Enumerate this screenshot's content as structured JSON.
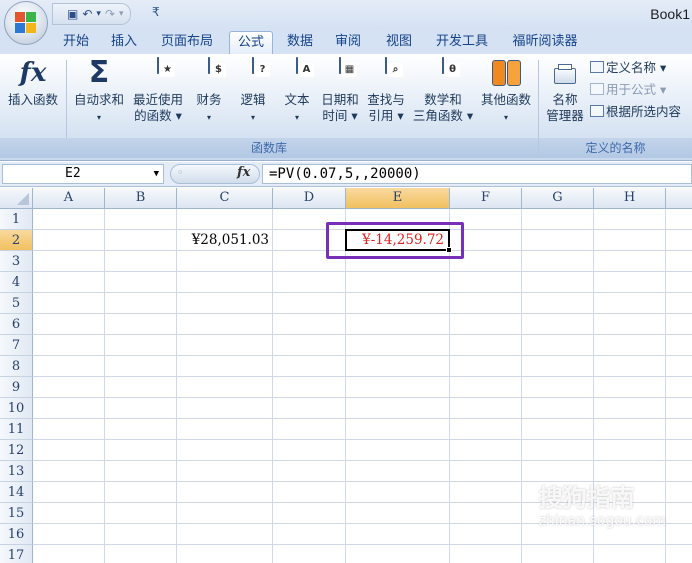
{
  "window": {
    "title": "Book1"
  },
  "quick_access": {
    "save": "▣",
    "undo": "↶",
    "undo_dd": "▾",
    "redo": "↷",
    "redo_dd": "▾",
    "customize": "₹"
  },
  "tabs": [
    {
      "label": "开始"
    },
    {
      "label": "插入"
    },
    {
      "label": "页面布局"
    },
    {
      "label": "公式",
      "active": true
    },
    {
      "label": "数据"
    },
    {
      "label": "审阅"
    },
    {
      "label": "视图"
    },
    {
      "label": "开发工具"
    },
    {
      "label": "福昕阅读器"
    }
  ],
  "ribbon": {
    "function_library": {
      "label": "函数库",
      "buttons": [
        {
          "line1": "插入函数",
          "line2": "",
          "icon": "fx-icon"
        },
        {
          "line1": "自动求和",
          "line2": "▾",
          "icon": "sigma-icon"
        },
        {
          "line1": "最近使用",
          "line2": "的函数 ▾",
          "icon": "recent-book-icon",
          "color": "#2f86d8",
          "glyph": "★"
        },
        {
          "line1": "财务",
          "line2": "▾",
          "icon": "finance-book-icon",
          "color": "#3aa04a",
          "glyph": "$"
        },
        {
          "line1": "逻辑",
          "line2": "▾",
          "icon": "logic-book-icon",
          "color": "#8e3fb5",
          "glyph": "?"
        },
        {
          "line1": "文本",
          "line2": "▾",
          "icon": "text-book-icon",
          "color": "#e3b62a",
          "glyph": "A"
        },
        {
          "line1": "日期和",
          "line2": "时间 ▾",
          "icon": "date-book-icon",
          "color": "#d8463a",
          "glyph": "▦"
        },
        {
          "line1": "查找与",
          "line2": "引用 ▾",
          "icon": "lookup-book-icon",
          "color": "#3a83c9",
          "glyph": "⌕"
        },
        {
          "line1": "数学和",
          "line2": "三角函数 ▾",
          "icon": "math-book-icon",
          "color": "#3b9a4a",
          "glyph": "θ"
        },
        {
          "line1": "其他函数",
          "line2": "▾",
          "icon": "more-books-icon",
          "color": "#f08a1e",
          "glyph": ""
        }
      ]
    },
    "defined_names": {
      "label": "定义的名称",
      "manager_line1": "名称",
      "manager_line2": "管理器",
      "define_name": "定义名称 ▾",
      "use_in_formula": "用于公式 ▾",
      "create_from_selection": "根据所选内容"
    }
  },
  "formula_bar": {
    "name_box": "E2",
    "fx_label": "fx",
    "formula": "=PV(0.07,5,,20000)"
  },
  "sheet": {
    "columns": [
      "A",
      "B",
      "C",
      "D",
      "E",
      "F",
      "G",
      "H"
    ],
    "selected_column": "E",
    "rows": [
      "1",
      "2",
      "3",
      "4",
      "5",
      "6",
      "7",
      "8",
      "9",
      "10",
      "11",
      "12",
      "13",
      "14",
      "15",
      "16",
      "17"
    ],
    "selected_row": "2",
    "cells": {
      "C2": {
        "value": "¥28,051.03",
        "color": "#000000"
      },
      "E2": {
        "value": "¥-14,259.72",
        "color": "#e02020"
      }
    }
  },
  "watermark": {
    "text": "搜狗指南",
    "sub": "zhinan.sogou.com"
  },
  "colors": {
    "annotation": "#7a2fb8",
    "selection_header": "#f4c66b",
    "ribbon_text": "#1e395b"
  }
}
